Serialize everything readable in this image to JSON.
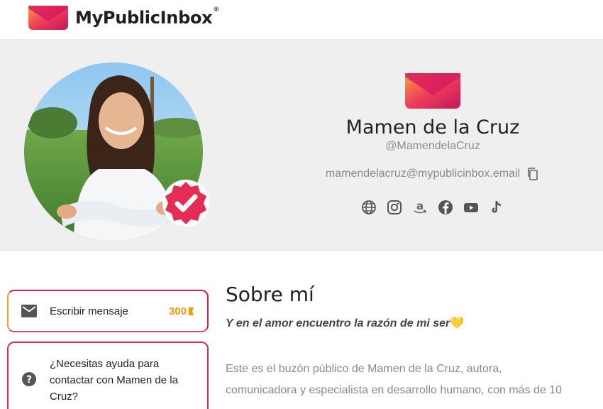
{
  "header": {
    "brand": "MyPublicInbox",
    "registered": "®"
  },
  "profile": {
    "name": "Mamen de la Cruz",
    "handle": "@MamendelaCruz",
    "email": "mamendelacruz@mypublicinbox.email",
    "socials": [
      "web-icon",
      "instagram-icon",
      "amazon-icon",
      "facebook-icon",
      "youtube-icon",
      "tiktok-icon"
    ]
  },
  "actions": {
    "write_label": "Escribir mensaje",
    "write_price": "300",
    "help_text": "¿Necesitas ayuda para contactar con Mamen de la Cruz?"
  },
  "about": {
    "title": "Sobre mí",
    "quote": "Y en el amor encuentro la razón de mi ser",
    "quote_emoji": "💛",
    "line1": "Este es el buzón público de Mamen de la Cruz, autora,",
    "line2": "comunicadora y especialista en desarrollo humano, con más de 10"
  },
  "colors": {
    "brand_red": "#e0285a",
    "brand_orange": "#f59a3a",
    "price": "#f39c12",
    "hero_bg": "#efefef"
  }
}
